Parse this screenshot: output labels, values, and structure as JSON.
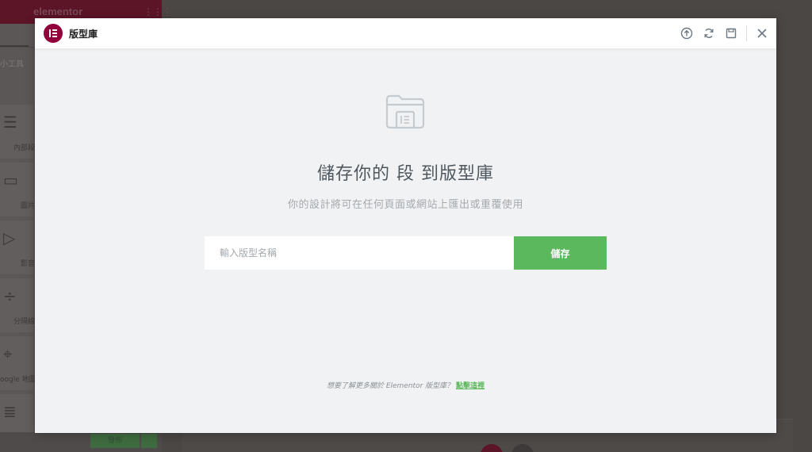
{
  "background_editor": {
    "logo": "elementor",
    "search_hint": "小工具",
    "widgets": [
      {
        "label": "內部段",
        "icon": "inner-section-icon"
      },
      {
        "label": "圖片",
        "icon": "image-icon"
      },
      {
        "label": "影音",
        "icon": "video-icon"
      },
      {
        "label": "分隔線",
        "icon": "divider-icon"
      },
      {
        "label": "oogle 地圖",
        "icon": "map-icon"
      },
      {
        "label": "",
        "icon": "text-editor-icon"
      }
    ],
    "publish_label": "發佈"
  },
  "modal": {
    "title": "版型庫",
    "header_icons": [
      "upload-icon",
      "sync-icon",
      "save-icon",
      "close-icon"
    ],
    "heading": "儲存你的 段 到版型庫",
    "subheading": "你的設計將可在任何頁面或網站上匯出或重覆使用",
    "input_placeholder": "輸入版型名稱",
    "input_value": "",
    "save_label": "儲存",
    "footer_text": "想要了解更多關於 Elementor 版型庫？",
    "footer_link": "點擊這裡"
  },
  "colors": {
    "brand": "#92003b",
    "accent_green": "#5cb85c",
    "modal_bg": "#f1f2f3"
  }
}
